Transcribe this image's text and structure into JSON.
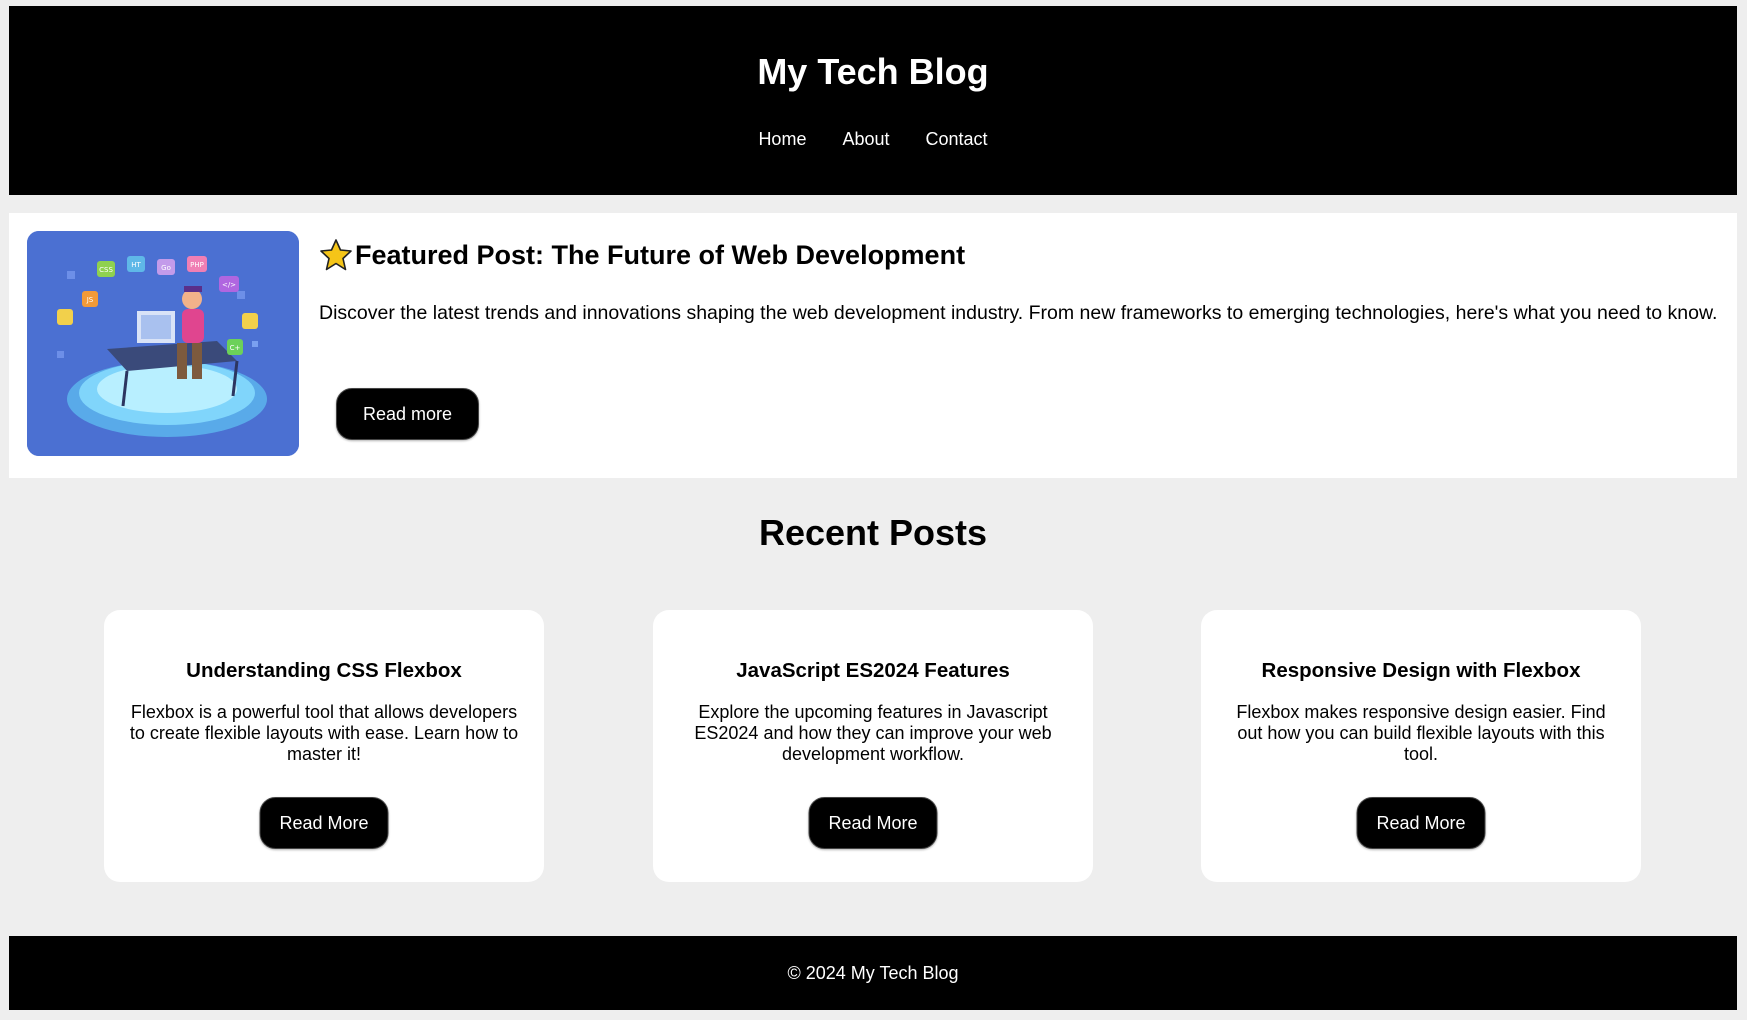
{
  "header": {
    "title": "My Tech Blog",
    "nav": [
      "Home",
      "About",
      "Contact"
    ]
  },
  "featured": {
    "title": "Featured Post: The Future of Web Development",
    "description": "Discover the latest trends and innovations shaping the web development industry. From new frameworks to emerging technologies, here's what you need to know.",
    "button_label": "Read more",
    "icon": "star-icon",
    "image": "developer-illustration"
  },
  "recent": {
    "heading": "Recent Posts",
    "posts": [
      {
        "title": "Understanding CSS Flexbox",
        "text": "Flexbox is a powerful tool that allows developers to create flexible layouts with ease. Learn how to master it!",
        "button_label": "Read More"
      },
      {
        "title": "JavaScript ES2024 Features",
        "text": "Explore the upcoming features in Javascript ES2024 and how they can improve your web development workflow.",
        "button_label": "Read More"
      },
      {
        "title": "Responsive Design with Flexbox",
        "text": "Flexbox makes responsive design easier. Find out how you can build flexible layouts with this tool.",
        "button_label": "Read More"
      }
    ]
  },
  "footer": {
    "text": "© 2024 My Tech Blog"
  },
  "colors": {
    "background": "#eeeeee",
    "header_bg": "#000000",
    "card_bg": "#ffffff",
    "button_bg": "#000000",
    "illustration_bg": "#4b70d2",
    "star": "#f5c518"
  }
}
